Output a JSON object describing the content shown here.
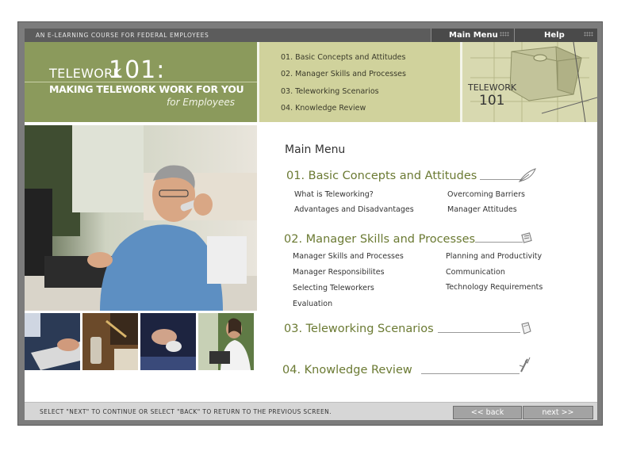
{
  "top_bar": {
    "tagline": "AN E-LEARNING COURSE FOR FEDERAL EMPLOYEES",
    "main_menu_label": "Main Menu",
    "help_label": "Help"
  },
  "header": {
    "logo_word": "TELEWORK",
    "logo_number": "101:",
    "logo_subtitle": "MAKING TELEWORK WORK FOR YOU",
    "logo_audience": "for Employees",
    "modules": [
      "01.  Basic Concepts and Attitudes",
      "02.  Manager Skills and Processes",
      "03.  Teleworking Scenarios",
      "04.  Knowledge Review"
    ],
    "badge_word": "TELEWORK",
    "badge_number": "101"
  },
  "main": {
    "title": "Main Menu",
    "sections": [
      {
        "title": "01. Basic Concepts and Attitudes",
        "icon": "feather-quill-icon",
        "links_left": [
          "What is Teleworking?",
          "Advantages and Disadvantages"
        ],
        "links_right": [
          "Overcoming Barriers",
          "Manager Attitudes"
        ]
      },
      {
        "title": "02. Manager Skills and Processes",
        "icon": "notepad-icon",
        "links_left": [
          "Manager Skills and Processes",
          "Manager Responsibilites",
          "Selecting Teleworkers",
          "Evaluation"
        ],
        "links_right": [
          "Planning and Productivity",
          "Communication",
          "Technology Requirements"
        ]
      },
      {
        "title": "03. Teleworking Scenarios",
        "icon": "document-icon",
        "links_left": [],
        "links_right": []
      },
      {
        "title": "04. Knowledge Review",
        "icon": "pencil-check-icon",
        "links_left": [],
        "links_right": []
      }
    ]
  },
  "footer": {
    "instruction": "SELECT \"NEXT\" TO CONTINUE OR SELECT \"BACK\" TO RETURN TO THE PREVIOUS SCREEN.",
    "back_label": "<< back",
    "next_label": "next >>"
  },
  "colors": {
    "frame_gray": "#7c7c7c",
    "header_olive": "#8b9a5c",
    "header_khaki": "#d0d29c",
    "section_green": "#6b7a33",
    "footer_gray": "#d6d6d6"
  }
}
